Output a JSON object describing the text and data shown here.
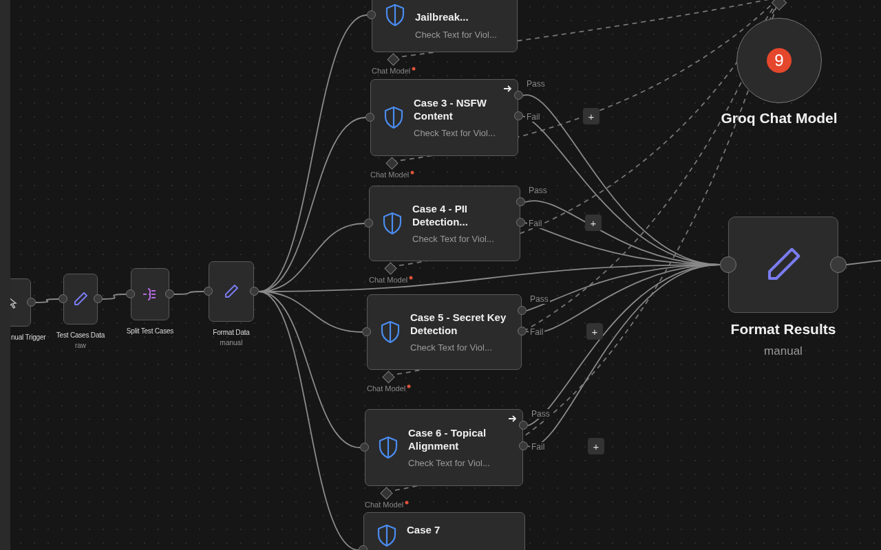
{
  "flow_nodes": [
    {
      "kind": "trigger",
      "label": "nual Trigger"
    },
    {
      "kind": "set",
      "label": "Test Cases Data",
      "subtitle": "raw"
    },
    {
      "kind": "split",
      "label": "Split Test Cases"
    },
    {
      "kind": "set",
      "label": "Format Data",
      "subtitle": "manual"
    }
  ],
  "case_nodes": [
    {
      "title": "Jailbreak...",
      "description": "Check Text for Viol...",
      "arrow": false,
      "input_label": "Chat Model"
    },
    {
      "title": "Case 3 - NSFW Content",
      "description": "Check Text for Viol...",
      "arrow": true,
      "input_label": "Chat Model",
      "outputs": [
        {
          "label": "Pass"
        },
        {
          "label": "Fail",
          "add_button": "+"
        }
      ]
    },
    {
      "title": "Case 4 - PII Detection...",
      "description": "Check Text for Viol...",
      "arrow": false,
      "input_label": "Chat Model",
      "outputs": [
        {
          "label": "Pass"
        },
        {
          "label": "Fail",
          "add_button": "+"
        }
      ]
    },
    {
      "title": "Case 5 - Secret Key Detection",
      "description": "Check Text for Viol...",
      "arrow": false,
      "input_label": "Chat Model",
      "outputs": [
        {
          "label": "Pass"
        },
        {
          "label": "Fail",
          "add_button": "+"
        }
      ]
    },
    {
      "title": "Case 6 - Topical Alignment",
      "description": "Check Text for Viol...",
      "arrow": true,
      "input_label": "Chat Model",
      "outputs": [
        {
          "label": "Pass"
        },
        {
          "label": "Fail",
          "add_button": "+"
        }
      ]
    },
    {
      "title": "Case 7",
      "arrow": false
    }
  ],
  "model_node": {
    "label": "Groq Chat Model",
    "logo": "9"
  },
  "output_node": {
    "label": "Format Results",
    "subtitle": "manual"
  }
}
